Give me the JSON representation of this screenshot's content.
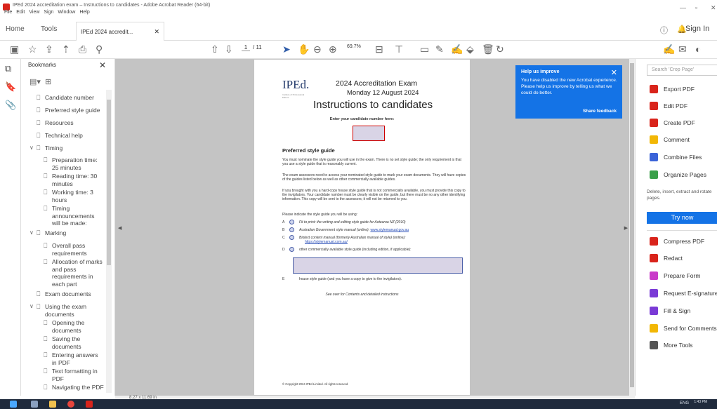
{
  "window": {
    "title": "IPEd 2024 accreditation exam – Instructions to candidates - Adobe Acrobat Reader (64-bit)",
    "menu": [
      "File",
      "Edit",
      "View",
      "Sign",
      "Window",
      "Help"
    ]
  },
  "tabs": {
    "home": "Home",
    "tools": "Tools",
    "document": "IPEd 2024 accredit...",
    "sign_in": "Sign In"
  },
  "toolbar": {
    "page_current": "1",
    "page_total": "/ 11",
    "zoom": "69.7%"
  },
  "bookmarks": {
    "title": "Bookmarks",
    "items": [
      {
        "label": "Candidate number"
      },
      {
        "label": "Preferred style guide"
      },
      {
        "label": "Resources"
      },
      {
        "label": "Technical help"
      },
      {
        "label": "Timing"
      },
      {
        "label": "Preparation time: 25 minutes"
      },
      {
        "label": "Reading time: 30 minutes"
      },
      {
        "label": "Working time: 3 hours"
      },
      {
        "label": "Timing announcements will be made:"
      },
      {
        "label": "Marking"
      },
      {
        "label": "Overall pass requirements"
      },
      {
        "label": "Allocation of marks and pass requirements in each part"
      },
      {
        "label": "Exam documents"
      },
      {
        "label": "Using the exam documents"
      },
      {
        "label": "Opening the documents"
      },
      {
        "label": "Saving the documents"
      },
      {
        "label": "Entering answers in PDF"
      },
      {
        "label": "Text formatting in PDF"
      },
      {
        "label": "Navigating the PDF"
      }
    ]
  },
  "page": {
    "logo": "IPEd.",
    "logo_sub": "Institute of Professional Editors",
    "exam_title": "2024 Accreditation Exam",
    "exam_date": "Monday 12 August 2024",
    "heading": "Instructions to candidates",
    "candidate_label": "Enter your candidate number here:",
    "section_heading": "Preferred style guide",
    "para1": "You must nominate the style guide you will use in the exam. There is no set style guide; the only requirement is that you use a style guide that is reasonably current.",
    "para2": "The exam assessors need to access your nominated style guide to mark your exam documents. They will have copies of the guides listed below as well as other commercially available guides.",
    "para3": "If you brought with you a hard-copy house style guide that is not commercially available, you must provide this copy to the invigilators. Your candidate number must be clearly visible on the guide, but there must be no any other identifying information. This copy will be sent to the assessors; it will not be returned to you.",
    "indicate": "Please indicate the style guide you will be using:",
    "options": [
      {
        "letter": "A",
        "text": "Fit to print: the writing and editing style guide for Aotearoa NZ (2010)"
      },
      {
        "letter": "B",
        "text": "Australian Government style manual (online):",
        "link": "www.stylemanual.gov.au"
      },
      {
        "letter": "C",
        "text": "Biotext content manual (formerly Australian manual of style) (online):",
        "link": "https://stylemanual.com.au/"
      },
      {
        "letter": "D",
        "text": "other commercially available style guide (including edition, if applicable):"
      },
      {
        "letter": "E",
        "text": "house style guide (and you have a copy to give to the invigilators)."
      }
    ],
    "see_over": "See over for Contents and detailed instructions",
    "copyright": "© Copyright 2024 IPEd Limited. All rights reserved."
  },
  "help_popup": {
    "title": "Help us improve",
    "body": "You have disabled the new Acrobat experience. Please help us improve by telling us what we could do better.",
    "link": "Share feedback"
  },
  "right_panel": {
    "search_placeholder": "Search 'Crop Page'",
    "tools_top": [
      {
        "label": "Export PDF",
        "color": "#d9241b",
        "has_arrow": true
      },
      {
        "label": "Edit PDF",
        "color": "#d9241b",
        "has_arrow": false
      },
      {
        "label": "Create PDF",
        "color": "#d9241b",
        "has_arrow": true
      },
      {
        "label": "Comment",
        "color": "#f2b705",
        "has_arrow": false
      },
      {
        "label": "Combine Files",
        "color": "#3b63d8",
        "has_arrow": false
      },
      {
        "label": "Organize Pages",
        "color": "#3aa04a",
        "has_arrow": true
      }
    ],
    "organize_desc": "Delete, insert, extract and rotate pages.",
    "try_now": "Try now",
    "tools_bottom": [
      {
        "label": "Compress PDF",
        "color": "#d9241b"
      },
      {
        "label": "Redact",
        "color": "#d9241b"
      },
      {
        "label": "Prepare Form",
        "color": "#c93ac9"
      },
      {
        "label": "Request E-signatures",
        "color": "#7a3ad6"
      },
      {
        "label": "Fill & Sign",
        "color": "#7a3ad6"
      },
      {
        "label": "Send for Comments",
        "color": "#f2b705"
      },
      {
        "label": "More Tools",
        "color": "#555555"
      }
    ]
  },
  "status": {
    "page_size": "8.27 x 11.69 in"
  },
  "taskbar": {
    "tray": "ENG",
    "time": "1:43 PM"
  }
}
